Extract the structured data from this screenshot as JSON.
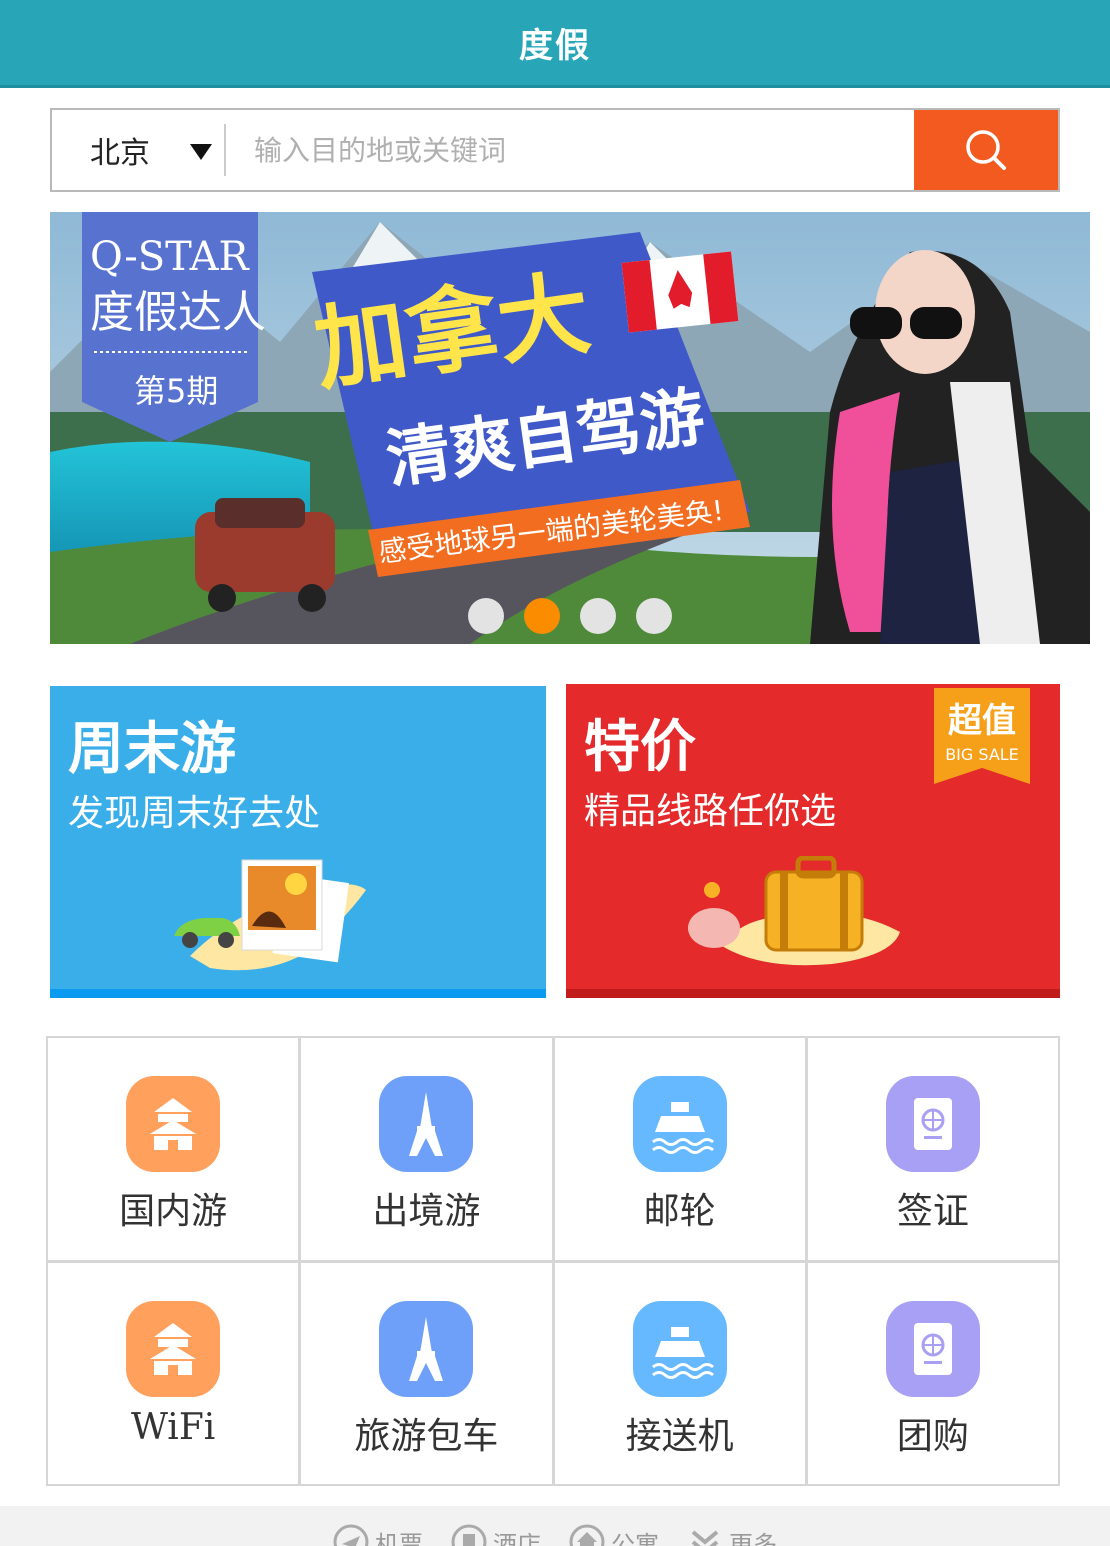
{
  "header": {
    "title": "度假"
  },
  "search": {
    "city": "北京",
    "placeholder": "输入目的地或关键词"
  },
  "banner": {
    "badge_title": "Q-STAR",
    "badge_sub": "度假达人",
    "badge_issue": "第5期",
    "headline": "加拿大",
    "subheadline": "清爽自驾游",
    "tagline": "感受地球另一端的美轮美奂!",
    "active_slide": 2,
    "slide_count": 4
  },
  "promo": {
    "weekend": {
      "title": "周末游",
      "subtitle": "发现周末好去处"
    },
    "sale": {
      "title": "特价",
      "subtitle": "精品线路任你选",
      "tag_cn": "超值",
      "tag_en": "BIG SALE"
    }
  },
  "categories": [
    {
      "label": "国内游",
      "icon": "temple-icon"
    },
    {
      "label": "出境游",
      "icon": "eiffel-tower-icon"
    },
    {
      "label": "邮轮",
      "icon": "ship-icon"
    },
    {
      "label": "签证",
      "icon": "passport-icon"
    },
    {
      "label": "WiFi",
      "icon": "temple-icon"
    },
    {
      "label": "旅游包车",
      "icon": "eiffel-tower-icon"
    },
    {
      "label": "接送机",
      "icon": "ship-icon"
    },
    {
      "label": "团购",
      "icon": "passport-icon"
    }
  ],
  "bottom_nav": [
    {
      "label": "机票",
      "icon": "plane-icon"
    },
    {
      "label": "酒店",
      "icon": "hotel-icon"
    },
    {
      "label": "公寓",
      "icon": "apartment-icon"
    },
    {
      "label": "更多",
      "icon": "more-icon"
    }
  ],
  "colors": {
    "header": "#28a6b8",
    "search_button": "#f25a1f",
    "weekend": "#3aaee9",
    "sale": "#e42a2a",
    "dot_active": "#fb8c00"
  }
}
